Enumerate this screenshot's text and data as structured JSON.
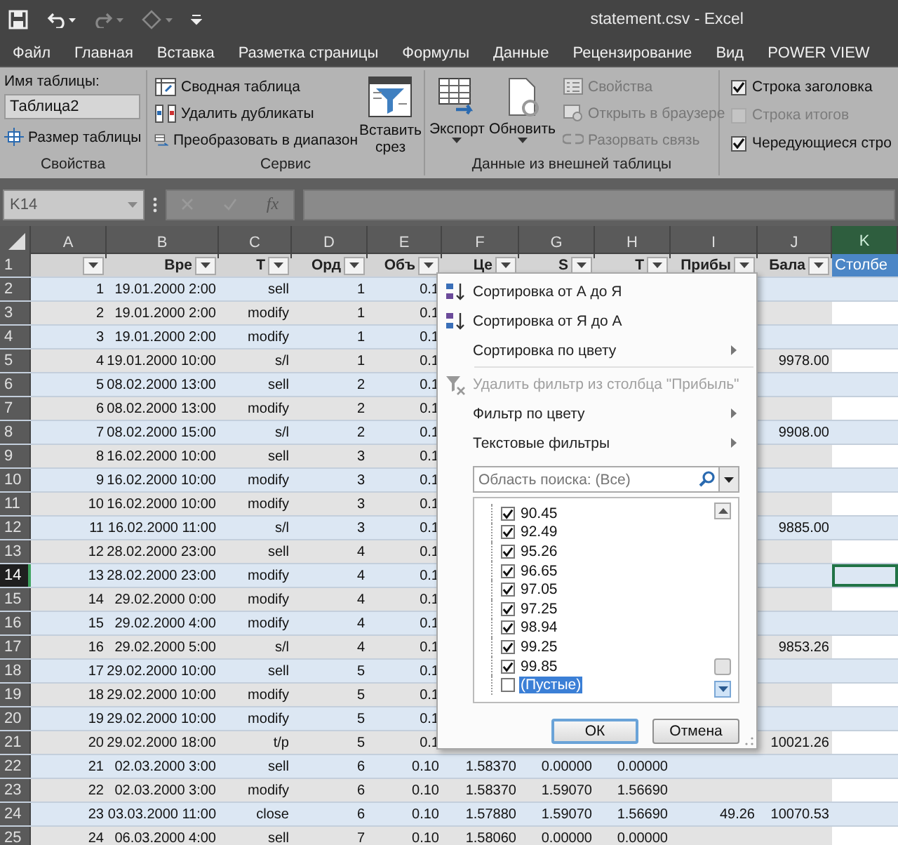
{
  "window": {
    "title": "statement.csv - Excel"
  },
  "tabs": [
    {
      "label": "Файл",
      "selected": false
    },
    {
      "label": "Главная",
      "selected": false
    },
    {
      "label": "Вставка",
      "selected": false
    },
    {
      "label": "Разметка страницы",
      "selected": false
    },
    {
      "label": "Формулы",
      "selected": false
    },
    {
      "label": "Данные",
      "selected": false
    },
    {
      "label": "Рецензирование",
      "selected": false
    },
    {
      "label": "Вид",
      "selected": false
    },
    {
      "label": "POWER VIEW",
      "selected": false
    }
  ],
  "ribbon": {
    "properties": {
      "name_label": "Имя таблицы:",
      "name_value": "Таблица2",
      "resize": "Размер таблицы",
      "caption": "Свойства"
    },
    "tools": {
      "items": [
        {
          "label": "Сводная таблица"
        },
        {
          "label": "Удалить дубликаты"
        },
        {
          "label": "Преобразовать в диапазон"
        }
      ],
      "slicer": [
        "Вставить",
        "срез"
      ],
      "caption": "Сервис"
    },
    "external": {
      "export": "Экспорт",
      "refresh": "Обновить",
      "items": [
        {
          "label": "Свойства",
          "disabled": true
        },
        {
          "label": "Открыть в браузере",
          "disabled": true
        },
        {
          "label": "Разорвать связь",
          "disabled": true
        }
      ],
      "caption": "Данные из внешней таблицы"
    },
    "style_options": [
      {
        "label": "Строка заголовка",
        "checked": true,
        "disabled": false
      },
      {
        "label": "Строка итогов",
        "checked": false,
        "disabled": true
      },
      {
        "label": "Чередующиеся стро",
        "checked": true,
        "disabled": false
      }
    ]
  },
  "formula_bar": {
    "name_box": "K14",
    "fx": "fx"
  },
  "sheet": {
    "columns": [
      {
        "letter": "A",
        "selected": false
      },
      {
        "letter": "B",
        "selected": false
      },
      {
        "letter": "C",
        "selected": false
      },
      {
        "letter": "D",
        "selected": false
      },
      {
        "letter": "E",
        "selected": false
      },
      {
        "letter": "F",
        "selected": false
      },
      {
        "letter": "G",
        "selected": false
      },
      {
        "letter": "H",
        "selected": false
      },
      {
        "letter": "I",
        "selected": false
      },
      {
        "letter": "J",
        "selected": false
      },
      {
        "letter": "K",
        "selected": true
      }
    ],
    "header_row": {
      "number": "1",
      "cells": {
        "A": {
          "filter": true,
          "highlighted": false
        },
        "B": {
          "label": "Вре",
          "filter": true,
          "highlighted": false
        },
        "C": {
          "label": "Т",
          "filter": true,
          "highlighted": false
        },
        "D": {
          "label": "Орд",
          "filter": true,
          "highlighted": false
        },
        "E": {
          "label": "Объ",
          "filter": true,
          "highlighted": false
        },
        "F": {
          "label": "Це",
          "filter": true,
          "highlighted": false
        },
        "G": {
          "label": "S",
          "filter": true,
          "highlighted": false
        },
        "H": {
          "label": "Т",
          "filter": true,
          "highlighted": false
        },
        "I": {
          "label": "Прибы",
          "filter": true,
          "highlighted": false
        },
        "J": {
          "label": "Бала",
          "filter": true,
          "highlighted": false
        },
        "K": {
          "label": "Столбе",
          "filter": false,
          "highlighted": true
        }
      }
    },
    "rows": [
      {
        "number": "2",
        "selected": false,
        "cells": {
          "A": "1",
          "B": "19.01.2000 2:00",
          "C": "sell",
          "D": "1",
          "E": "0.1"
        }
      },
      {
        "number": "3",
        "selected": false,
        "cells": {
          "A": "2",
          "B": "19.01.2000 2:00",
          "C": "modify",
          "D": "1",
          "E": "0.1"
        }
      },
      {
        "number": "4",
        "selected": false,
        "cells": {
          "A": "3",
          "B": "19.01.2000 2:00",
          "C": "modify",
          "D": "1",
          "E": "0.1"
        }
      },
      {
        "number": "5",
        "selected": false,
        "cells": {
          "A": "4",
          "B": "19.01.2000 10:00",
          "C": "s/l",
          "D": "1",
          "E": "0.1",
          "J": "9978.00"
        }
      },
      {
        "number": "6",
        "selected": false,
        "cells": {
          "A": "5",
          "B": "08.02.2000 13:00",
          "C": "sell",
          "D": "2",
          "E": "0.1"
        }
      },
      {
        "number": "7",
        "selected": false,
        "cells": {
          "A": "6",
          "B": "08.02.2000 13:00",
          "C": "modify",
          "D": "2",
          "E": "0.1"
        }
      },
      {
        "number": "8",
        "selected": false,
        "cells": {
          "A": "7",
          "B": "08.02.2000 15:00",
          "C": "s/l",
          "D": "2",
          "E": "0.1",
          "J": "9908.00"
        }
      },
      {
        "number": "9",
        "selected": false,
        "cells": {
          "A": "8",
          "B": "16.02.2000 10:00",
          "C": "sell",
          "D": "3",
          "E": "0.1"
        }
      },
      {
        "number": "10",
        "selected": false,
        "cells": {
          "A": "9",
          "B": "16.02.2000 10:00",
          "C": "modify",
          "D": "3",
          "E": "0.1"
        }
      },
      {
        "number": "11",
        "selected": false,
        "cells": {
          "A": "10",
          "B": "16.02.2000 10:00",
          "C": "modify",
          "D": "3",
          "E": "0.1"
        }
      },
      {
        "number": "12",
        "selected": false,
        "cells": {
          "A": "11",
          "B": "16.02.2000 11:00",
          "C": "s/l",
          "D": "3",
          "E": "0.1",
          "J": "9885.00"
        }
      },
      {
        "number": "13",
        "selected": false,
        "cells": {
          "A": "12",
          "B": "28.02.2000 23:00",
          "C": "sell",
          "D": "4",
          "E": "0.1"
        }
      },
      {
        "number": "14",
        "selected": true,
        "cells": {
          "A": "13",
          "B": "28.02.2000 23:00",
          "C": "modify",
          "D": "4",
          "E": "0.1"
        }
      },
      {
        "number": "15",
        "selected": false,
        "cells": {
          "A": "14",
          "B": "29.02.2000 0:00",
          "C": "modify",
          "D": "4",
          "E": "0.1"
        }
      },
      {
        "number": "16",
        "selected": false,
        "cells": {
          "A": "15",
          "B": "29.02.2000 4:00",
          "C": "modify",
          "D": "4",
          "E": "0.1"
        }
      },
      {
        "number": "17",
        "selected": false,
        "cells": {
          "A": "16",
          "B": "29.02.2000 5:00",
          "C": "s/l",
          "D": "4",
          "E": "0.1",
          "J": "9853.26"
        }
      },
      {
        "number": "18",
        "selected": false,
        "cells": {
          "A": "17",
          "B": "29.02.2000 10:00",
          "C": "sell",
          "D": "5",
          "E": "0.1"
        }
      },
      {
        "number": "19",
        "selected": false,
        "cells": {
          "A": "18",
          "B": "29.02.2000 10:00",
          "C": "modify",
          "D": "5",
          "E": "0.1"
        }
      },
      {
        "number": "20",
        "selected": false,
        "cells": {
          "A": "19",
          "B": "29.02.2000 10:00",
          "C": "modify",
          "D": "5",
          "E": "0.1"
        }
      },
      {
        "number": "21",
        "selected": false,
        "cells": {
          "A": "20",
          "B": "29.02.2000 18:00",
          "C": "t/p",
          "D": "5",
          "E": "0.1",
          "J": "10021.26"
        }
      },
      {
        "number": "22",
        "selected": false,
        "cells": {
          "A": "21",
          "B": "02.03.2000 3:00",
          "C": "sell",
          "D": "6",
          "E": "0.10",
          "F": "1.58370",
          "G": "0.00000",
          "H": "0.00000"
        }
      },
      {
        "number": "23",
        "selected": false,
        "cells": {
          "A": "22",
          "B": "02.03.2000 3:00",
          "C": "modify",
          "D": "6",
          "E": "0.10",
          "F": "1.58370",
          "G": "1.59070",
          "H": "1.56690"
        }
      },
      {
        "number": "24",
        "selected": false,
        "cells": {
          "A": "23",
          "B": "03.03.2000 11:00",
          "C": "close",
          "D": "6",
          "E": "0.10",
          "F": "1.57880",
          "G": "1.59070",
          "H": "1.56690",
          "I": "49.26",
          "J": "10070.53"
        }
      },
      {
        "number": "25",
        "selected": false,
        "cells": {
          "A": "24",
          "B": "06.03.2000 4:00",
          "C": "sell",
          "D": "7",
          "E": "0.10",
          "F": "1.58060",
          "G": "0.00000",
          "H": "0.00000"
        }
      }
    ]
  },
  "filter_menu": {
    "items": [
      {
        "kind": "sort-asc",
        "label": "Сортировка от А до Я",
        "submenu": false,
        "disabled": false
      },
      {
        "kind": "sort-desc",
        "label": "Сортировка от Я до А",
        "submenu": false,
        "disabled": false
      },
      {
        "kind": "command",
        "label": "Сортировка по цвету",
        "submenu": true,
        "disabled": false
      },
      {
        "kind": "separator"
      },
      {
        "kind": "clear-filter",
        "label": "Удалить фильтр из столбца \"Прибыль\"",
        "submenu": false,
        "disabled": true
      },
      {
        "kind": "command",
        "label": "Фильтр по цвету",
        "submenu": true,
        "disabled": false
      },
      {
        "kind": "command",
        "label": "Текстовые фильтры",
        "submenu": true,
        "disabled": false
      }
    ],
    "search": {
      "placeholder": "Область поиска: (Все)"
    },
    "values": [
      {
        "label": "90.45",
        "checked": true,
        "selected": false
      },
      {
        "label": "92.49",
        "checked": true,
        "selected": false
      },
      {
        "label": "95.26",
        "checked": true,
        "selected": false
      },
      {
        "label": "96.65",
        "checked": true,
        "selected": false
      },
      {
        "label": "97.05",
        "checked": true,
        "selected": false
      },
      {
        "label": "97.25",
        "checked": true,
        "selected": false
      },
      {
        "label": "98.94",
        "checked": true,
        "selected": false
      },
      {
        "label": "99.25",
        "checked": true,
        "selected": false
      },
      {
        "label": "99.85",
        "checked": true,
        "selected": false
      },
      {
        "label": "(Пустые)",
        "checked": false,
        "selected": true
      }
    ],
    "buttons": [
      {
        "label": "ОК",
        "default": true
      },
      {
        "label": "Отмена",
        "default": false
      }
    ]
  }
}
